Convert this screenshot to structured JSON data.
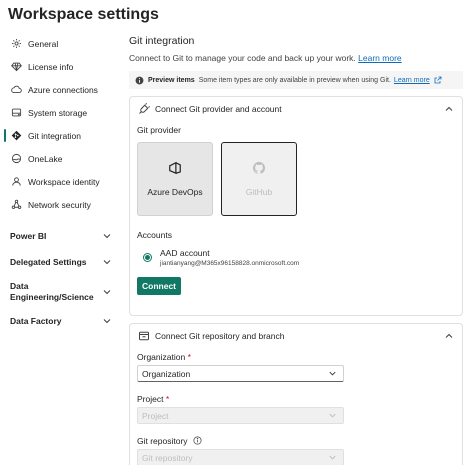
{
  "page": {
    "title": "Workspace settings"
  },
  "sidebar": {
    "items": [
      {
        "label": "General",
        "icon": "gear-icon"
      },
      {
        "label": "License info",
        "icon": "diamond-icon"
      },
      {
        "label": "Azure connections",
        "icon": "cloud-icon"
      },
      {
        "label": "System storage",
        "icon": "storage-icon"
      },
      {
        "label": "Git integration",
        "icon": "git-icon",
        "active": true
      },
      {
        "label": "OneLake",
        "icon": "onelake-icon"
      },
      {
        "label": "Workspace identity",
        "icon": "identity-icon"
      },
      {
        "label": "Network security",
        "icon": "network-icon"
      }
    ],
    "groups": [
      {
        "label": "Power BI"
      },
      {
        "label": "Delegated Settings"
      },
      {
        "label": "Data Engineering/Science"
      },
      {
        "label": "Data Factory"
      }
    ]
  },
  "git": {
    "title": "Git integration",
    "subtitle": "Connect to Git to manage your code and back up your work.",
    "learn_more": "Learn more"
  },
  "banner": {
    "bold": "Preview items",
    "text": "Some item types are only available in preview when using Git.",
    "link": "Learn more"
  },
  "provider_card": {
    "title": "Connect Git provider and account",
    "provider_label": "Git provider",
    "providers": [
      {
        "label": "Azure DevOps"
      },
      {
        "label": "GitHub"
      }
    ],
    "accounts_label": "Accounts",
    "account_name": "AAD account",
    "account_email": "jiantianyang@M365x96158828.onmicrosoft.com",
    "connect_label": "Connect"
  },
  "repo_card": {
    "title": "Connect Git repository and branch",
    "organization_label": "Organization",
    "organization_value": "Organization",
    "project_label": "Project",
    "project_value": "Project",
    "repository_label": "Git repository",
    "repository_value": "Git repository",
    "required_mark": "*"
  },
  "colors": {
    "accent": "#117865",
    "link": "#0f6cbd",
    "required": "#c50f1f"
  }
}
